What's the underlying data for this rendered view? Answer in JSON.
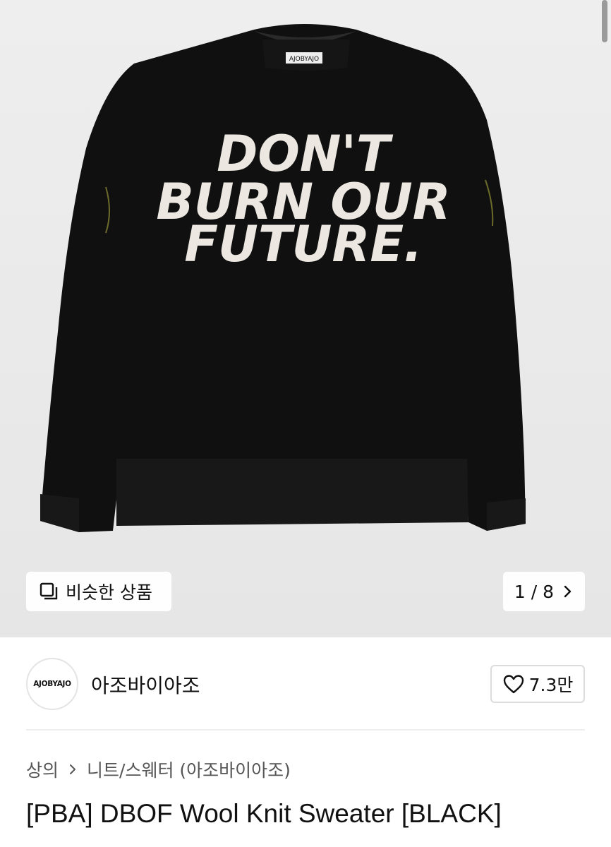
{
  "gallery": {
    "image_alt": "Black knit sweater",
    "graphic_text": [
      "DON'T",
      "BURN OUR",
      "FUTURE."
    ],
    "neck_label": "AJOBYAJO",
    "similar_label": "비슷한 상품",
    "counter": "1 / 8"
  },
  "brand": {
    "logo_text": "AJOBYAJO",
    "name": "아조바이아조",
    "likes": "7.3만"
  },
  "breadcrumb": {
    "category": "상의",
    "subcategory": "니트/스웨터 (아조바이아조)"
  },
  "product": {
    "title": "[PBA] DBOF Wool Knit Sweater [BLACK]"
  },
  "colors": {
    "hero_bg": "#ebebeb",
    "sweater": "#101010",
    "graphic": "#ece8e1"
  },
  "icons": [
    "similar-items-icon",
    "chevron-right-icon",
    "heart-icon",
    "breadcrumb-chevron-icon"
  ]
}
